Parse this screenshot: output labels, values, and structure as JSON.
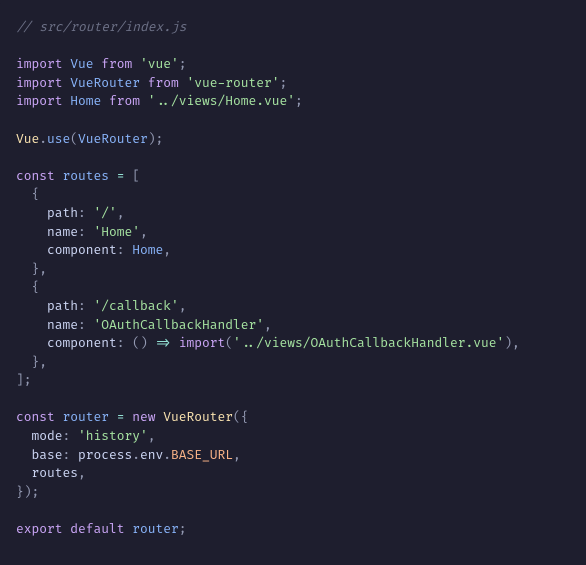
{
  "code": {
    "t00": "// src/router/index.js",
    "t01": "import",
    "t02": "Vue",
    "t03": "from",
    "t04": "'vue'",
    "t05": ";",
    "t06": "import",
    "t07": "VueRouter",
    "t08": "from",
    "t09": "'vue-router'",
    "t10": ";",
    "t11": "import",
    "t12": "Home",
    "t13": "from",
    "t14": "'../views/Home.vue'",
    "t15": ";",
    "t16": "Vue",
    "t17": ".",
    "t18": "use",
    "t19": "(",
    "t20": "VueRouter",
    "t21": ")",
    "t22": ";",
    "t23": "const",
    "t24": "routes",
    "t25": "=",
    "t26": "[",
    "t27": "{",
    "t28": "path",
    "t29": ":",
    "t30": "'/'",
    "t31": ",",
    "t32": "name",
    "t33": ":",
    "t34": "'Home'",
    "t35": ",",
    "t36": "component",
    "t37": ":",
    "t38": "Home",
    "t39": ",",
    "t40": "}",
    "t41": ",",
    "t42": "{",
    "t43": "path",
    "t44": ":",
    "t45": "'/callback'",
    "t46": ",",
    "t47": "name",
    "t48": ":",
    "t49": "'OAuthCallbackHandler'",
    "t50": ",",
    "t51": "component",
    "t52": ":",
    "t53": "(",
    "t54": ")",
    "t55": "=>",
    "t56": "import",
    "t57": "(",
    "t58": "'../views/OAuthCallbackHandler.vue'",
    "t59": ")",
    "t60": ",",
    "t61": "}",
    "t62": ",",
    "t63": "]",
    "t64": ";",
    "t65": "const",
    "t66": "router",
    "t67": "=",
    "t68": "new",
    "t69": "VueRouter",
    "t70": "(",
    "t71": "{",
    "t72": "mode",
    "t73": ":",
    "t74": "'history'",
    "t75": ",",
    "t76": "base",
    "t77": ":",
    "t78": "process",
    "t79": ".",
    "t80": "env",
    "t81": ".",
    "t82": "BASE_URL",
    "t83": ",",
    "t84": "routes",
    "t85": ",",
    "t86": "}",
    "t87": ")",
    "t88": ";",
    "t89": "export",
    "t90": "default",
    "t91": "router",
    "t92": ";"
  }
}
